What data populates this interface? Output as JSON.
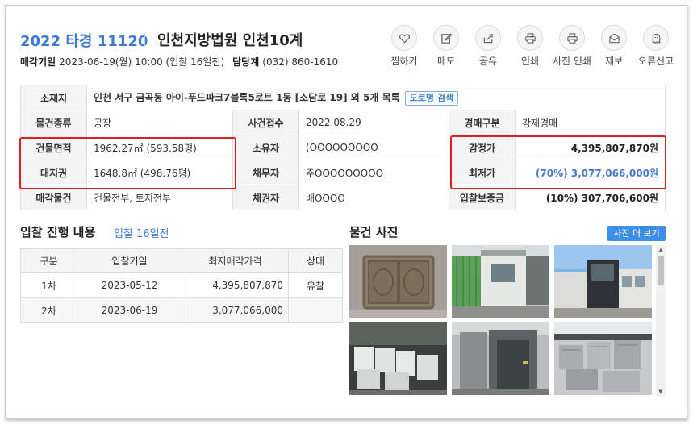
{
  "header": {
    "case_number": "2022 타경 11120",
    "court": "인천지방법원 인천10계",
    "sale_date_label": "매각기일",
    "sale_date_value": "2023-06-19(월) 10:00 (입찰 16일전)",
    "manager_label": "담당계",
    "manager_value": "(032) 860-1610"
  },
  "actions": [
    {
      "label": "찜하기",
      "icon": "heart-icon"
    },
    {
      "label": "메모",
      "icon": "edit-icon"
    },
    {
      "label": "공유",
      "icon": "share-icon"
    },
    {
      "label": "인쇄",
      "icon": "print-icon"
    },
    {
      "label": "사진 인쇄",
      "icon": "photo-print-icon"
    },
    {
      "label": "제보",
      "icon": "mail-icon"
    },
    {
      "label": "오류신고",
      "icon": "ghost-icon"
    }
  ],
  "info": {
    "location_label": "소재지",
    "location_value": "인천 서구 금곡동 아이-푸드파크7블록5로트 1동 [소담로 19] 외 5개 목록",
    "road_search": "도로명 검색",
    "type_label": "물건종류",
    "type_value": "공장",
    "received_label": "사건접수",
    "received_value": "2022.08.29",
    "auction_kind_label": "경매구분",
    "auction_kind_value": "강제경매",
    "building_area_label": "건물면적",
    "building_area_value": "1962.27㎡ (593.58평)",
    "owner_label": "소유자",
    "owner_value": "(OOOOOOOOO",
    "appraisal_label": "감정가",
    "appraisal_value": "4,395,807,870원",
    "land_right_label": "대지권",
    "land_right_value": "1648.8㎡ (498.76평)",
    "debtor_label": "채무자",
    "debtor_value": "주OOOOOOOOO",
    "min_price_label": "최저가",
    "min_price_value": "(70%) 3,077,066,000원",
    "sale_item_label": "매각물건",
    "sale_item_value": "건물전부, 토지전부",
    "creditor_label": "채권자",
    "creditor_value": "배OOOO",
    "deposit_label": "입찰보증금",
    "deposit_value": "(10%) 307,706,600원"
  },
  "bid_section": {
    "title": "입찰 진행 내용",
    "subtitle": "입찰 16일전",
    "headers": [
      "구분",
      "입찰기일",
      "최저매각가격",
      "상태"
    ],
    "rows": [
      {
        "round": "1차",
        "date": "2023-05-12",
        "price": "4,395,807,870",
        "status": "유찰"
      },
      {
        "round": "2차",
        "date": "2023-06-19",
        "price": "3,077,066,000",
        "status": ""
      }
    ]
  },
  "photo_section": {
    "title": "물건 사진",
    "more_button": "사진 더 보기"
  },
  "colors": {
    "accent": "#3b7bd4",
    "highlight": "#e02020",
    "button_blue": "#3d8ee6"
  }
}
